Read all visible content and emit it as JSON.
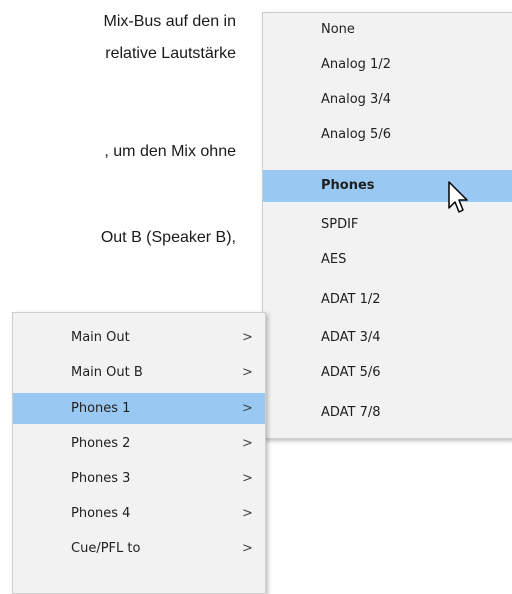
{
  "document": {
    "lines": [
      "Mix-Bus auf den in",
      "relative Lautstärke",
      ", um den Mix ohne",
      "Out B (Speaker B),"
    ]
  },
  "output_menu": {
    "items": [
      {
        "label": "None"
      },
      {
        "label": "Analog 1/2"
      },
      {
        "label": "Analog 3/4"
      },
      {
        "label": "Analog 5/6"
      },
      {
        "label": "Phones",
        "selected": true
      },
      {
        "label": "SPDIF"
      },
      {
        "label": "AES"
      },
      {
        "label": "ADAT 1/2"
      },
      {
        "label": "ADAT 3/4"
      },
      {
        "label": "ADAT 5/6"
      },
      {
        "label": "ADAT 7/8"
      }
    ]
  },
  "bus_menu": {
    "items": [
      {
        "label": "Main Out",
        "arrow": ">"
      },
      {
        "label": "Main Out B",
        "arrow": ">"
      },
      {
        "label": "Phones 1",
        "arrow": ">",
        "selected": true
      },
      {
        "label": "Phones 2",
        "arrow": ">"
      },
      {
        "label": "Phones 3",
        "arrow": ">"
      },
      {
        "label": "Phones 4",
        "arrow": ">"
      },
      {
        "label": "Cue/PFL to",
        "arrow": ">"
      }
    ]
  },
  "colors": {
    "selection": "#99c9f2",
    "menu_bg": "#f2f2f2"
  },
  "cursor": {
    "icon": "arrow-pointer-icon"
  }
}
